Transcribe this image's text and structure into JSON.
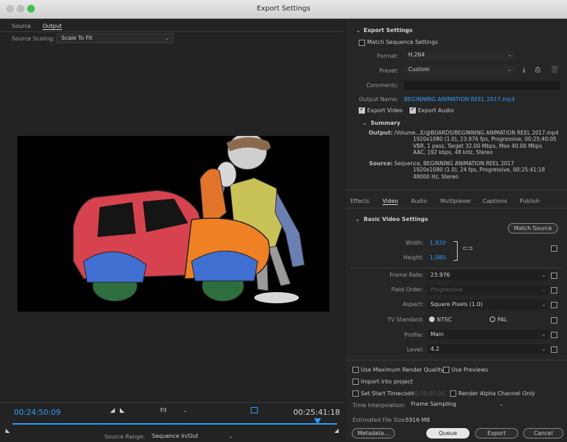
{
  "window": {
    "title": "Export Settings"
  },
  "left": {
    "tabs": [
      "Source",
      "Output"
    ],
    "source_scaling_label": "Source Scaling:",
    "source_scaling_value": "Scale To Fit",
    "timecode_in": "00:24:50:09",
    "timecode_out": "00:25:41:18",
    "fit_value": "Fit",
    "source_range_label": "Source Range:",
    "source_range_value": "Sequence In/Out",
    "playhead_fraction": 0.94
  },
  "export_settings": {
    "header": "Export Settings",
    "match_sequence": "Match Sequence Settings",
    "format_label": "Format:",
    "format_value": "H.264",
    "preset_label": "Preset:",
    "preset_value": "Custom",
    "comments_label": "Comments:",
    "output_name_label": "Output Name:",
    "output_name_value": "BEGINNING ANIMATION REEL 2017.mp4",
    "export_video": "Export Video",
    "export_audio": "Export Audio"
  },
  "summary": {
    "header": "Summary",
    "output_label": "Output:",
    "output_lines": [
      "/Volume...E/@BOARDS/BEGINNING ANIMATION REEL 2017.mp4",
      "1920x1080 (1.0), 23.976 fps, Progressive, 00:25:40:05",
      "VBR, 1 pass, Target 32.00 Mbps, Max 40.00 Mbps",
      "AAC, 192 kbps, 48 kHz, Stereo"
    ],
    "source_label": "Source:",
    "source_lines": [
      "Sequence, BEGINNING ANIMATION REEL 2017",
      "1920x1080 (1.0), 24 fps, Progressive, 00:25:41:18",
      "48000 Hz, Stereo"
    ]
  },
  "tabs2": [
    "Effects",
    "Video",
    "Audio",
    "Multiplexer",
    "Captions",
    "Publish"
  ],
  "video": {
    "header": "Basic Video Settings",
    "match_source": "Match Source",
    "width_label": "Width:",
    "width_value": "1,920",
    "height_label": "Height:",
    "height_value": "1,080",
    "frame_rate_label": "Frame Rate:",
    "frame_rate_value": "23.976",
    "field_order_label": "Field Order:",
    "field_order_value": "Progressive",
    "aspect_label": "Aspect:",
    "aspect_value": "Square Pixels (1.0)",
    "tv_standard_label": "TV Standard:",
    "ntsc": "NTSC",
    "pal": "PAL",
    "profile_label": "Profile:",
    "profile_value": "Main",
    "level_label": "Level:",
    "level_value": "4.2"
  },
  "bottom": {
    "max_render": "Use Maximum Render Quality",
    "use_previews": "Use Previews",
    "import_project": "Import into project",
    "set_start_timecode": "Set Start Timecode",
    "start_timecode_value": "00:00:00:00",
    "render_alpha": "Render Alpha Channel Only",
    "time_interp_label": "Time Interpolation:",
    "time_interp_value": "Frame Sampling",
    "file_size_label": "Estimated File Size:",
    "file_size_value": "5916 MB",
    "metadata": "Metadata...",
    "queue": "Queue",
    "export": "Export",
    "cancel": "Cancel"
  },
  "colors": {
    "accent": "#2c9eff",
    "background": "#232323"
  }
}
